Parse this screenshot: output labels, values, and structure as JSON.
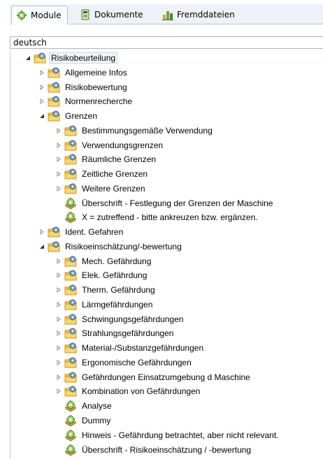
{
  "tabs": [
    {
      "label": "Module",
      "icon": "module-icon",
      "active": true
    },
    {
      "label": "Dokumente",
      "icon": "document-icon",
      "active": false
    },
    {
      "label": "Fremddateien",
      "icon": "chart-icon",
      "active": false
    }
  ],
  "search": {
    "value": "deutsch"
  },
  "colors": {
    "folder": "#f4c63a",
    "folder_dark": "#c9962b",
    "gear_green": "#7dbf4a",
    "tab_border": "#b9c4d4"
  },
  "tree": {
    "items": [
      {
        "label": "Risikobeurteilung",
        "type": "folder",
        "expander": "expanded",
        "level": 0
      },
      {
        "label": "Allgemeine Infos",
        "type": "folder",
        "expander": "collapsed",
        "level": 1
      },
      {
        "label": "Risikobewertung",
        "type": "folder",
        "expander": "collapsed",
        "level": 1
      },
      {
        "label": "Normenrecherche",
        "type": "folder",
        "expander": "collapsed",
        "level": 1
      },
      {
        "label": "Grenzen",
        "type": "folder",
        "expander": "expanded",
        "level": 1
      },
      {
        "label": "Bestimmungsgemäße Verwendung",
        "type": "folder",
        "expander": "collapsed",
        "level": 2
      },
      {
        "label": "Verwendungsgrenzen",
        "type": "folder",
        "expander": "collapsed",
        "level": 2
      },
      {
        "label": "Räumliche Grenzen",
        "type": "folder",
        "expander": "collapsed",
        "level": 2
      },
      {
        "label": "Zeitliche Grenzen",
        "type": "folder",
        "expander": "collapsed",
        "level": 2
      },
      {
        "label": "Weitere Grenzen",
        "type": "folder",
        "expander": "collapsed",
        "level": 2
      },
      {
        "label": "Überschrift - Festlegung der Grenzen der Maschine",
        "type": "module",
        "expander": "none",
        "level": 2
      },
      {
        "label": "X = zutreffend - bitte ankreuzen bzw. ergänzen.",
        "type": "module",
        "expander": "none",
        "level": 2
      },
      {
        "label": "Ident. Gefahren",
        "type": "folder",
        "expander": "collapsed",
        "level": 1
      },
      {
        "label": "Risikoeinschätzung/-bewertung",
        "type": "folder",
        "expander": "expanded",
        "level": 1
      },
      {
        "label": "Mech. Gefährdung",
        "type": "folder",
        "expander": "collapsed",
        "level": 2
      },
      {
        "label": "Elek. Gefährdung",
        "type": "folder",
        "expander": "collapsed",
        "level": 2
      },
      {
        "label": "Therm. Gefährdung",
        "type": "folder",
        "expander": "collapsed",
        "level": 2
      },
      {
        "label": "Lärmgefährdungen",
        "type": "folder",
        "expander": "collapsed",
        "level": 2
      },
      {
        "label": "Schwingungsgefährdungen",
        "type": "folder",
        "expander": "collapsed",
        "level": 2
      },
      {
        "label": "Strahlungsgefährdungen",
        "type": "folder",
        "expander": "collapsed",
        "level": 2
      },
      {
        "label": "Material-/Substanzgefährdungen",
        "type": "folder",
        "expander": "collapsed",
        "level": 2
      },
      {
        "label": "Ergonomische Gefährdungen",
        "type": "folder",
        "expander": "collapsed",
        "level": 2
      },
      {
        "label": "Gefährdungen Einsatzumgebung d Maschine",
        "type": "folder",
        "expander": "collapsed",
        "level": 2
      },
      {
        "label": "Kombination von Gefährdungen",
        "type": "folder",
        "expander": "collapsed",
        "level": 2
      },
      {
        "label": "Analyse",
        "type": "module",
        "expander": "none",
        "level": 2
      },
      {
        "label": "Dummy",
        "type": "module",
        "expander": "none",
        "level": 2
      },
      {
        "label": "Hinweis - Gefährdung betrachtet, aber nicht relevant.",
        "type": "module",
        "expander": "none",
        "level": 2
      },
      {
        "label": "Überschrift - Risikoeinschätzung / -bewertung",
        "type": "module",
        "expander": "none",
        "level": 2
      }
    ]
  }
}
